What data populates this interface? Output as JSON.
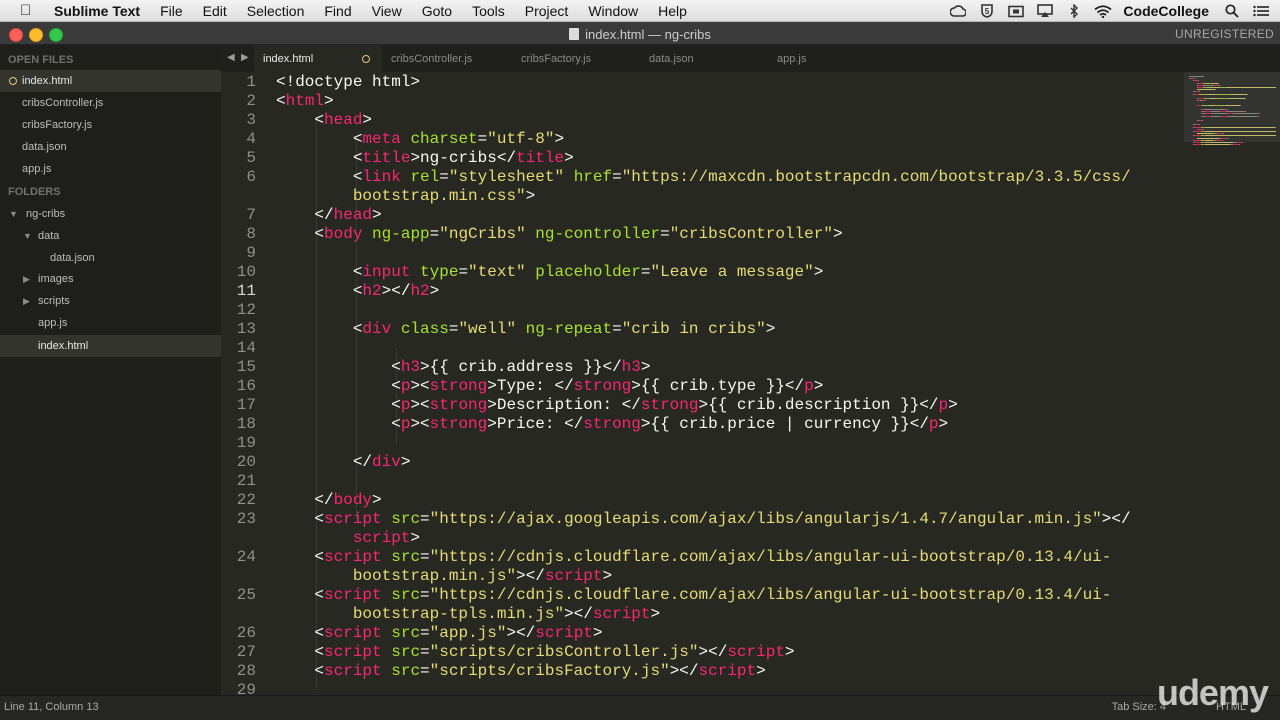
{
  "menubar": {
    "app_name": "Sublime Text",
    "items": [
      "File",
      "Edit",
      "Selection",
      "Find",
      "View",
      "Goto",
      "Tools",
      "Project",
      "Window",
      "Help"
    ],
    "user": "CodeCollege",
    "status_icons": [
      "creative-cloud-icon",
      "shield-icon",
      "camera-icon",
      "airplay-icon",
      "bluetooth-icon",
      "wifi-icon"
    ]
  },
  "window": {
    "title": "index.html — ng-cribs",
    "registration": "UNREGISTERED"
  },
  "sidebar": {
    "open_files_header": "OPEN FILES",
    "open_files": [
      {
        "name": "index.html",
        "selected": true
      },
      {
        "name": "cribsController.js"
      },
      {
        "name": "cribsFactory.js"
      },
      {
        "name": "data.json"
      },
      {
        "name": "app.js"
      }
    ],
    "folders_header": "FOLDERS",
    "tree": [
      {
        "name": "ng-cribs",
        "type": "folder",
        "expanded": true
      },
      {
        "name": "data",
        "type": "folder",
        "expanded": true
      },
      {
        "name": "data.json",
        "type": "file"
      },
      {
        "name": "images",
        "type": "folder",
        "expanded": false
      },
      {
        "name": "scripts",
        "type": "folder",
        "expanded": false
      },
      {
        "name": "app.js",
        "type": "file"
      },
      {
        "name": "index.html",
        "type": "file",
        "selected": true
      }
    ]
  },
  "tabs": [
    {
      "name": "index.html",
      "active": true,
      "modified": true
    },
    {
      "name": "cribsController.js"
    },
    {
      "name": "cribsFactory.js"
    },
    {
      "name": "data.json"
    },
    {
      "name": "app.js"
    }
  ],
  "code_lines": [
    {
      "n": "1",
      "segs": [
        [
          "d",
          "<!doctype html>"
        ]
      ]
    },
    {
      "n": "2",
      "segs": [
        [
          "d",
          "<"
        ],
        [
          "t",
          "html"
        ],
        [
          "d",
          ">"
        ]
      ]
    },
    {
      "n": "3",
      "segs": [
        [
          "d",
          "    <"
        ],
        [
          "t",
          "head"
        ],
        [
          "d",
          ">"
        ]
      ]
    },
    {
      "n": "4",
      "segs": [
        [
          "d",
          "        <"
        ],
        [
          "t",
          "meta "
        ],
        [
          "a",
          "charset"
        ],
        [
          "d",
          "="
        ],
        [
          "s",
          "\"utf-8\""
        ],
        [
          "d",
          ">"
        ]
      ]
    },
    {
      "n": "5",
      "segs": [
        [
          "d",
          "        <"
        ],
        [
          "t",
          "title"
        ],
        [
          "d",
          ">ng-cribs</"
        ],
        [
          "t",
          "title"
        ],
        [
          "d",
          ">"
        ]
      ]
    },
    {
      "n": "6",
      "segs": [
        [
          "d",
          "        <"
        ],
        [
          "t",
          "link "
        ],
        [
          "a",
          "rel"
        ],
        [
          "d",
          "="
        ],
        [
          "s",
          "\"stylesheet\" "
        ],
        [
          "a",
          "href"
        ],
        [
          "d",
          "="
        ],
        [
          "s",
          "\"https://maxcdn.bootstrapcdn.com/bootstrap/3.3.5/css/"
        ]
      ]
    },
    {
      "n": "",
      "segs": [
        [
          "s",
          "        bootstrap.min.css\""
        ],
        [
          "d",
          ">"
        ]
      ]
    },
    {
      "n": "7",
      "segs": [
        [
          "d",
          "    </"
        ],
        [
          "t",
          "head"
        ],
        [
          "d",
          ">"
        ]
      ]
    },
    {
      "n": "8",
      "segs": [
        [
          "d",
          "    <"
        ],
        [
          "t",
          "body "
        ],
        [
          "a",
          "ng-app"
        ],
        [
          "d",
          "="
        ],
        [
          "s",
          "\"ngCribs\" "
        ],
        [
          "a",
          "ng-controller"
        ],
        [
          "d",
          "="
        ],
        [
          "s",
          "\"cribsController\""
        ],
        [
          "d",
          ">"
        ]
      ]
    },
    {
      "n": "9",
      "segs": [
        [
          "d",
          ""
        ]
      ]
    },
    {
      "n": "10",
      "segs": [
        [
          "d",
          "        <"
        ],
        [
          "t",
          "input "
        ],
        [
          "a",
          "type"
        ],
        [
          "d",
          "="
        ],
        [
          "s",
          "\"text\" "
        ],
        [
          "a",
          "placeholder"
        ],
        [
          "d",
          "="
        ],
        [
          "s",
          "\"Leave a message\""
        ],
        [
          "d",
          ">"
        ]
      ]
    },
    {
      "n": "11",
      "segs": [
        [
          "d",
          "        <"
        ],
        [
          "t",
          "h2"
        ],
        [
          "d",
          "></"
        ],
        [
          "t",
          "h2"
        ],
        [
          "d",
          ">"
        ]
      ]
    },
    {
      "n": "12",
      "segs": [
        [
          "d",
          ""
        ]
      ]
    },
    {
      "n": "13",
      "segs": [
        [
          "d",
          "        <"
        ],
        [
          "t",
          "div "
        ],
        [
          "a",
          "class"
        ],
        [
          "d",
          "="
        ],
        [
          "s",
          "\"well\" "
        ],
        [
          "a",
          "ng-repeat"
        ],
        [
          "d",
          "="
        ],
        [
          "s",
          "\"crib in cribs\""
        ],
        [
          "d",
          ">"
        ]
      ]
    },
    {
      "n": "14",
      "segs": [
        [
          "d",
          ""
        ]
      ]
    },
    {
      "n": "15",
      "segs": [
        [
          "d",
          "            <"
        ],
        [
          "t",
          "h3"
        ],
        [
          "d",
          ">{{ crib.address }}</"
        ],
        [
          "t",
          "h3"
        ],
        [
          "d",
          ">"
        ]
      ]
    },
    {
      "n": "16",
      "segs": [
        [
          "d",
          "            <"
        ],
        [
          "t",
          "p"
        ],
        [
          "d",
          "><"
        ],
        [
          "t",
          "strong"
        ],
        [
          "d",
          ">Type: </"
        ],
        [
          "t",
          "strong"
        ],
        [
          "d",
          ">{{ crib.type }}</"
        ],
        [
          "t",
          "p"
        ],
        [
          "d",
          ">"
        ]
      ]
    },
    {
      "n": "17",
      "segs": [
        [
          "d",
          "            <"
        ],
        [
          "t",
          "p"
        ],
        [
          "d",
          "><"
        ],
        [
          "t",
          "strong"
        ],
        [
          "d",
          ">Description: </"
        ],
        [
          "t",
          "strong"
        ],
        [
          "d",
          ">{{ crib.description }}</"
        ],
        [
          "t",
          "p"
        ],
        [
          "d",
          ">"
        ]
      ]
    },
    {
      "n": "18",
      "segs": [
        [
          "d",
          "            <"
        ],
        [
          "t",
          "p"
        ],
        [
          "d",
          "><"
        ],
        [
          "t",
          "strong"
        ],
        [
          "d",
          ">Price: </"
        ],
        [
          "t",
          "strong"
        ],
        [
          "d",
          ">{{ crib.price | currency }}</"
        ],
        [
          "t",
          "p"
        ],
        [
          "d",
          ">"
        ]
      ]
    },
    {
      "n": "19",
      "segs": [
        [
          "d",
          ""
        ]
      ]
    },
    {
      "n": "20",
      "segs": [
        [
          "d",
          "        </"
        ],
        [
          "t",
          "div"
        ],
        [
          "d",
          ">"
        ]
      ]
    },
    {
      "n": "21",
      "segs": [
        [
          "d",
          ""
        ]
      ]
    },
    {
      "n": "22",
      "segs": [
        [
          "d",
          "    </"
        ],
        [
          "t",
          "body"
        ],
        [
          "d",
          ">"
        ]
      ]
    },
    {
      "n": "23",
      "segs": [
        [
          "d",
          "    <"
        ],
        [
          "t",
          "script "
        ],
        [
          "a",
          "src"
        ],
        [
          "d",
          "="
        ],
        [
          "s",
          "\"https://ajax.googleapis.com/ajax/libs/angularjs/1.4.7/angular.min.js\""
        ],
        [
          "d",
          "></"
        ]
      ]
    },
    {
      "n": "",
      "segs": [
        [
          "t",
          "        script"
        ],
        [
          "d",
          ">"
        ]
      ]
    },
    {
      "n": "24",
      "segs": [
        [
          "d",
          "    <"
        ],
        [
          "t",
          "script "
        ],
        [
          "a",
          "src"
        ],
        [
          "d",
          "="
        ],
        [
          "s",
          "\"https://cdnjs.cloudflare.com/ajax/libs/angular-ui-bootstrap/0.13.4/ui-"
        ]
      ]
    },
    {
      "n": "",
      "segs": [
        [
          "s",
          "        bootstrap.min.js\""
        ],
        [
          "d",
          "></"
        ],
        [
          "t",
          "script"
        ],
        [
          "d",
          ">"
        ]
      ]
    },
    {
      "n": "25",
      "segs": [
        [
          "d",
          "    <"
        ],
        [
          "t",
          "script "
        ],
        [
          "a",
          "src"
        ],
        [
          "d",
          "="
        ],
        [
          "s",
          "\"https://cdnjs.cloudflare.com/ajax/libs/angular-ui-bootstrap/0.13.4/ui-"
        ]
      ]
    },
    {
      "n": "",
      "segs": [
        [
          "s",
          "        bootstrap-tpls.min.js\""
        ],
        [
          "d",
          "></"
        ],
        [
          "t",
          "script"
        ],
        [
          "d",
          ">"
        ]
      ]
    },
    {
      "n": "26",
      "segs": [
        [
          "d",
          "    <"
        ],
        [
          "t",
          "script "
        ],
        [
          "a",
          "src"
        ],
        [
          "d",
          "="
        ],
        [
          "s",
          "\"app.js\""
        ],
        [
          "d",
          "></"
        ],
        [
          "t",
          "script"
        ],
        [
          "d",
          ">"
        ]
      ]
    },
    {
      "n": "27",
      "segs": [
        [
          "d",
          "    <"
        ],
        [
          "t",
          "script "
        ],
        [
          "a",
          "src"
        ],
        [
          "d",
          "="
        ],
        [
          "s",
          "\"scripts/cribsController.js\""
        ],
        [
          "d",
          "></"
        ],
        [
          "t",
          "script"
        ],
        [
          "d",
          ">"
        ]
      ]
    },
    {
      "n": "28",
      "segs": [
        [
          "d",
          "    <"
        ],
        [
          "t",
          "script "
        ],
        [
          "a",
          "src"
        ],
        [
          "d",
          "="
        ],
        [
          "s",
          "\"scripts/cribsFactory.js\""
        ],
        [
          "d",
          "></"
        ],
        [
          "t",
          "script"
        ],
        [
          "d",
          ">"
        ]
      ]
    },
    {
      "n": "29",
      "segs": [
        [
          "d",
          ""
        ]
      ]
    }
  ],
  "statusbar": {
    "position": "Line 11, Column 13",
    "tab_size": "Tab Size: 4",
    "syntax": "HTML"
  },
  "watermark": "udemy",
  "colors": {
    "tag": "#f92672",
    "attribute": "#a6e22e",
    "string": "#e6db74",
    "text": "#f8f8f2",
    "background": "#272822"
  }
}
